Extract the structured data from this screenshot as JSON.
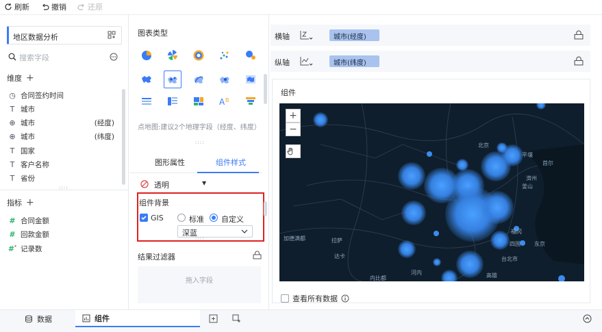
{
  "toolbar": {
    "refresh": "刷新",
    "undo": "撤销",
    "redo": "还原"
  },
  "left": {
    "dataset": "地区数据分析",
    "search_placeholder": "搜索字段",
    "dimension_title": "维度",
    "dimensions": [
      {
        "icon": "clock-icon",
        "label": "合同签约时间",
        "extra": ""
      },
      {
        "icon": "text-icon",
        "label": "城市",
        "extra": ""
      },
      {
        "icon": "globe-icon",
        "label": "城市",
        "extra": "(经度)"
      },
      {
        "icon": "globe-icon",
        "label": "城市",
        "extra": "(纬度)"
      },
      {
        "icon": "text-icon",
        "label": "国家",
        "extra": ""
      },
      {
        "icon": "text-icon",
        "label": "客户名称",
        "extra": ""
      },
      {
        "icon": "text-icon",
        "label": "省份",
        "extra": ""
      }
    ],
    "measure_title": "指标",
    "measures": [
      {
        "icon": "hash-icon",
        "label": "合同金额"
      },
      {
        "icon": "hash-icon",
        "label": "回款金额"
      },
      {
        "icon": "hash-star-icon",
        "label": "记录数"
      }
    ]
  },
  "mid": {
    "chart_type_title": "图表类型",
    "chart_hint": "点地图:建议2个地理字段（经度、纬度）",
    "tabs": {
      "graph_props": "图形属性",
      "component_style": "组件样式"
    },
    "opacity": "透明",
    "bg_title": "组件背景",
    "gis": "GIS",
    "standard": "标准",
    "custom": "自定义",
    "select_value": "深蓝",
    "filter_title": "结果过滤器",
    "drop_hint": "拖入字段"
  },
  "right": {
    "x_axis_label": "横轴",
    "x_axis_field": "城市(经度)",
    "y_axis_label": "纵轴",
    "y_axis_field": "城市(纬度)",
    "widget_title": "组件",
    "map_labels": [
      "北京",
      "平壤",
      "首尔",
      "釜山",
      "加德满都",
      "拉萨",
      "达卡",
      "河内",
      "内比都",
      "台北市",
      "高雄",
      "东京",
      "福冈",
      "四国",
      "濟州"
    ],
    "view_all": "查看所有数据"
  },
  "bottom": {
    "data_tab": "数据",
    "widget_tab": "组件"
  },
  "colors": {
    "accent": "#3a7cf7",
    "map_bg": "#0f1e2c",
    "bubble": "#3d8fef",
    "highlight": "#e02020"
  }
}
